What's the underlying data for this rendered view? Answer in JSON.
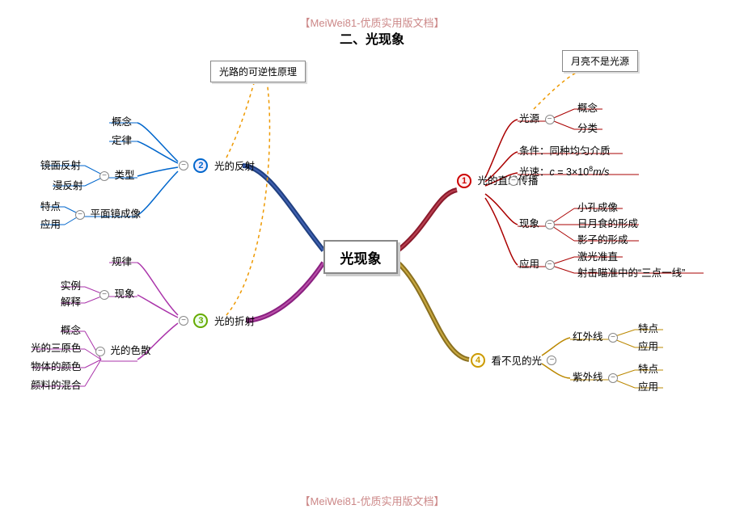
{
  "header": {
    "tag": "【MeiWei81-优质实用版文档】",
    "title": "二、光现象"
  },
  "footer": {
    "tag": "【MeiWei81-优质实用版文档】"
  },
  "center": "光现象",
  "callouts": {
    "reversibility": "光路的可逆性原理",
    "moon": "月亮不是光源"
  },
  "branch1": {
    "title": "光的直线传播",
    "lightSource": {
      "label": "光源",
      "concept": "概念",
      "classify": "分类"
    },
    "condition": "条件：同种均匀介质",
    "speed_prefix": "光速：",
    "phenomena": {
      "label": "现象",
      "a": "小孔成像",
      "b": "日月食的形成",
      "c": "影子的形成"
    },
    "apps": {
      "label": "应用",
      "a": "激光准直",
      "b": "射击瞄准中的“三点一线”"
    }
  },
  "branch2": {
    "title": "光的反射",
    "concept": "概念",
    "law": "定律",
    "type": {
      "label": "类型",
      "specular": "镜面反射",
      "diffuse": "漫反射"
    },
    "mirror": {
      "label": "平面镜成像",
      "feature": "特点",
      "app": "应用"
    }
  },
  "branch3": {
    "title": "光的折射",
    "rule": "规律",
    "phenomena": {
      "label": "现象",
      "example": "实例",
      "explain": "解释"
    },
    "dispersion": {
      "label": "光的色散",
      "concept": "概念",
      "primary": "光的三原色",
      "objcolor": "物体的颜色",
      "pigment": "颜料的混合"
    }
  },
  "branch4": {
    "title": "看不见的光",
    "ir": {
      "label": "红外线",
      "feature": "特点",
      "app": "应用"
    },
    "uv": {
      "label": "紫外线",
      "feature": "特点",
      "app": "应用"
    }
  },
  "chart_data": {
    "type": "mindmap",
    "title": "光现象",
    "root": "光现象",
    "children": [
      {
        "n": 1,
        "label": "光的直线传播",
        "children": [
          {
            "label": "光源",
            "children": [
              "概念",
              "分类"
            ],
            "note": "月亮不是光源"
          },
          {
            "label": "条件：同种均匀介质"
          },
          {
            "label": "光速：c = 3×10^8 m/s"
          },
          {
            "label": "现象",
            "children": [
              "小孔成像",
              "日月食的形成",
              "影子的形成"
            ]
          },
          {
            "label": "应用",
            "children": [
              "激光准直",
              "射击瞄准中的“三点一线”"
            ]
          }
        ]
      },
      {
        "n": 2,
        "label": "光的反射",
        "note": "光路的可逆性原理",
        "children": [
          "概念",
          "定律",
          {
            "label": "类型",
            "children": [
              "镜面反射",
              "漫反射"
            ]
          },
          {
            "label": "平面镜成像",
            "children": [
              "特点",
              "应用"
            ]
          }
        ]
      },
      {
        "n": 3,
        "label": "光的折射",
        "note": "光路的可逆性原理",
        "children": [
          "规律",
          {
            "label": "现象",
            "children": [
              "实例",
              "解释"
            ]
          },
          {
            "label": "光的色散",
            "children": [
              "概念",
              "光的三原色",
              "物体的颜色",
              "颜料的混合"
            ]
          }
        ]
      },
      {
        "n": 4,
        "label": "看不见的光",
        "children": [
          {
            "label": "红外线",
            "children": [
              "特点",
              "应用"
            ]
          },
          {
            "label": "紫外线",
            "children": [
              "特点",
              "应用"
            ]
          }
        ]
      }
    ]
  }
}
